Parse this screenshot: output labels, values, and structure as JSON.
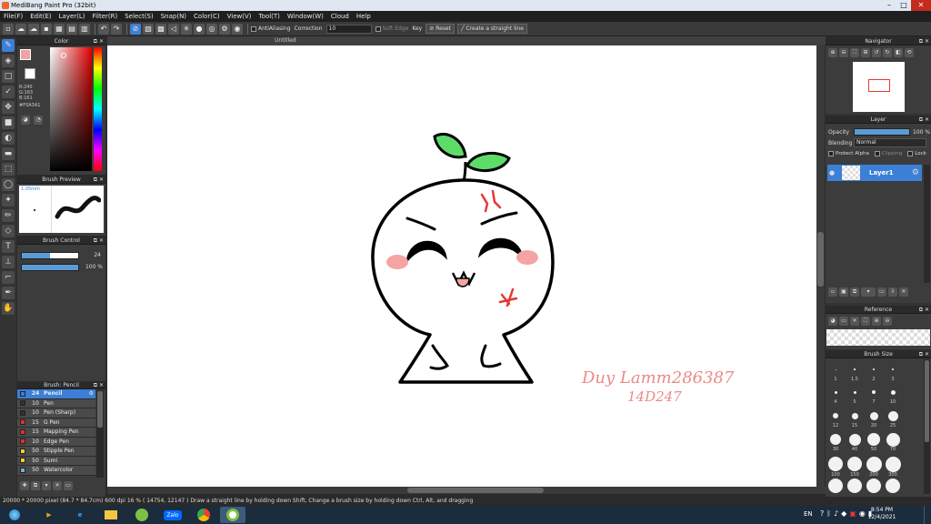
{
  "window": {
    "title": "MediBang Paint Pro (32bit)"
  },
  "menu": [
    "File(F)",
    "Edit(E)",
    "Layer(L)",
    "Filter(R)",
    "Select(S)",
    "Snap(N)",
    "Color(C)",
    "View(V)",
    "Tool(T)",
    "Window(W)",
    "Cloud",
    "Help"
  ],
  "toolbar": {
    "antialiasing": "AntiAliasing",
    "correction_label": "Correction",
    "correction_value": "10",
    "soft_edge": "Soft Edge",
    "key": "Key",
    "reset": "Reset",
    "create_line": "Create a straight line"
  },
  "color_panel": {
    "title": "Color",
    "r": "R:240",
    "g": "G:163",
    "b": "B:161",
    "hex": "#F0A3A1",
    "current_color": "#F0A3A1"
  },
  "brush_preview": {
    "title": "Brush Preview",
    "size": "1.05mm"
  },
  "brush_control": {
    "title": "Brush Control",
    "size_value": "24",
    "opacity_value": "100 %"
  },
  "brush_list": {
    "title": "Brush: Pencil",
    "items": [
      {
        "size": "24",
        "name": "Pencil",
        "color": "#3c7fd6"
      },
      {
        "size": "10",
        "name": "Pen",
        "color": "#333333"
      },
      {
        "size": "10",
        "name": "Pen (Sharp)",
        "color": "#333333"
      },
      {
        "size": "15",
        "name": "G Pen",
        "color": "#e03030"
      },
      {
        "size": "15",
        "name": "Mapping Pen",
        "color": "#e03030"
      },
      {
        "size": "10",
        "name": "Edge Pen",
        "color": "#e03030"
      },
      {
        "size": "50",
        "name": "Stipple Pen",
        "color": "#f0d020"
      },
      {
        "size": "50",
        "name": "Sumi",
        "color": "#f0d020"
      },
      {
        "size": "50",
        "name": "Watercolor",
        "color": "#6ab0e0"
      }
    ]
  },
  "document": {
    "tab_title": "Untitled"
  },
  "canvas": {
    "signature_line1": "Duy Lamm286387",
    "signature_line2": "14D247"
  },
  "navigator": {
    "title": "Navigator"
  },
  "layer_panel": {
    "title": "Layer",
    "opacity_label": "Opacity",
    "opacity_value": "100 %",
    "blending_label": "Blending",
    "blending_value": "Normal",
    "protect_alpha": "Protect Alpha",
    "clipping": "Clipping",
    "lock": "Lock",
    "layer_name": "Layer1"
  },
  "reference": {
    "title": "Reference"
  },
  "brush_size": {
    "title": "Brush Size",
    "sizes": [
      "1",
      "1.5",
      "2",
      "3",
      "4",
      "5",
      "7",
      "10",
      "12",
      "15",
      "20",
      "25",
      "30",
      "40",
      "50",
      "70",
      "100",
      "150",
      "200",
      "300"
    ]
  },
  "status": {
    "text": "20000 * 20000 pixel  (84.7 * 84.7cm)  600 dpi  16 %  ( 14754, 12147 )  Draw a straight line by holding down Shift, Change a brush size by holding down Ctrl, Alt, and dragging"
  },
  "taskbar": {
    "lang": "EN",
    "time": "8:54 PM",
    "date": "12/4/2021",
    "zalo": "Zalo"
  }
}
